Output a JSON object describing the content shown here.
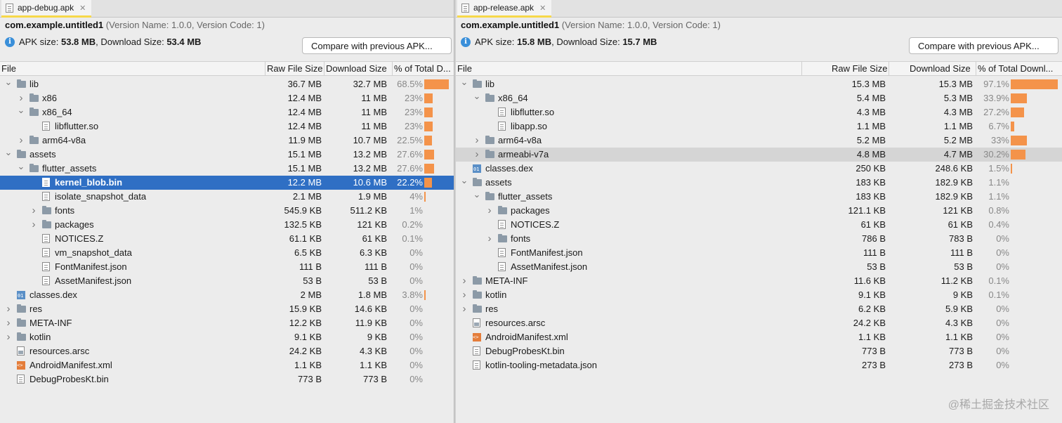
{
  "left": {
    "tab": "app-debug.apk",
    "package": "com.example.untitled1",
    "version_info": "(Version Name: 1.0.0, Version Code: 1)",
    "apk_size_label": "APK size:",
    "apk_size": "53.8 MB",
    "download_size_label": "Download Size:",
    "download_size": "53.4 MB",
    "compare_button": "Compare with previous APK...",
    "columns": [
      "File",
      "Raw File Size",
      "Download Size",
      "% of Total D..."
    ],
    "rows": [
      {
        "depth": 0,
        "arrow": "down",
        "icon": "folder",
        "name": "lib",
        "raw": "36.7 MB",
        "dl": "32.7 MB",
        "pct": "68.5%",
        "frac": 0.685
      },
      {
        "depth": 1,
        "arrow": "right",
        "icon": "folder",
        "name": "x86",
        "raw": "12.4 MB",
        "dl": "11 MB",
        "pct": "23%",
        "frac": 0.23
      },
      {
        "depth": 1,
        "arrow": "down",
        "icon": "folder",
        "name": "x86_64",
        "raw": "12.4 MB",
        "dl": "11 MB",
        "pct": "23%",
        "frac": 0.23
      },
      {
        "depth": 2,
        "arrow": "",
        "icon": "file",
        "name": "libflutter.so",
        "raw": "12.4 MB",
        "dl": "11 MB",
        "pct": "23%",
        "frac": 0.23
      },
      {
        "depth": 1,
        "arrow": "right",
        "icon": "folder",
        "name": "arm64-v8a",
        "raw": "11.9 MB",
        "dl": "10.7 MB",
        "pct": "22.5%",
        "frac": 0.225
      },
      {
        "depth": 0,
        "arrow": "down",
        "icon": "folder",
        "name": "assets",
        "raw": "15.1 MB",
        "dl": "13.2 MB",
        "pct": "27.6%",
        "frac": 0.276
      },
      {
        "depth": 1,
        "arrow": "down",
        "icon": "folder",
        "name": "flutter_assets",
        "raw": "15.1 MB",
        "dl": "13.2 MB",
        "pct": "27.6%",
        "frac": 0.276
      },
      {
        "depth": 2,
        "arrow": "",
        "icon": "file",
        "name": "kernel_blob.bin",
        "raw": "12.2 MB",
        "dl": "10.6 MB",
        "pct": "22.2%",
        "frac": 0.222,
        "selected": true
      },
      {
        "depth": 2,
        "arrow": "",
        "icon": "file",
        "name": "isolate_snapshot_data",
        "raw": "2.1 MB",
        "dl": "1.9 MB",
        "pct": "4%",
        "frac": 0.04
      },
      {
        "depth": 2,
        "arrow": "right",
        "icon": "folder",
        "name": "fonts",
        "raw": "545.9 KB",
        "dl": "511.2 KB",
        "pct": "1%",
        "frac": 0
      },
      {
        "depth": 2,
        "arrow": "right",
        "icon": "folder",
        "name": "packages",
        "raw": "132.5 KB",
        "dl": "121 KB",
        "pct": "0.2%",
        "frac": 0
      },
      {
        "depth": 2,
        "arrow": "",
        "icon": "file",
        "name": "NOTICES.Z",
        "raw": "61.1 KB",
        "dl": "61 KB",
        "pct": "0.1%",
        "frac": 0
      },
      {
        "depth": 2,
        "arrow": "",
        "icon": "file",
        "name": "vm_snapshot_data",
        "raw": "6.5 KB",
        "dl": "6.3 KB",
        "pct": "0%",
        "frac": 0
      },
      {
        "depth": 2,
        "arrow": "",
        "icon": "file",
        "name": "FontManifest.json",
        "raw": "111 B",
        "dl": "111 B",
        "pct": "0%",
        "frac": 0
      },
      {
        "depth": 2,
        "arrow": "",
        "icon": "file",
        "name": "AssetManifest.json",
        "raw": "53 B",
        "dl": "53 B",
        "pct": "0%",
        "frac": 0
      },
      {
        "depth": 0,
        "arrow": "",
        "icon": "dex",
        "name": "classes.dex",
        "raw": "2 MB",
        "dl": "1.8 MB",
        "pct": "3.8%",
        "frac": 0.038
      },
      {
        "depth": 0,
        "arrow": "right",
        "icon": "folder",
        "name": "res",
        "raw": "15.9 KB",
        "dl": "14.6 KB",
        "pct": "0%",
        "frac": 0
      },
      {
        "depth": 0,
        "arrow": "right",
        "icon": "folder",
        "name": "META-INF",
        "raw": "12.2 KB",
        "dl": "11.9 KB",
        "pct": "0%",
        "frac": 0
      },
      {
        "depth": 0,
        "arrow": "right",
        "icon": "folder",
        "name": "kotlin",
        "raw": "9.1 KB",
        "dl": "9 KB",
        "pct": "0%",
        "frac": 0
      },
      {
        "depth": 0,
        "arrow": "",
        "icon": "bin",
        "name": "resources.arsc",
        "raw": "24.2 KB",
        "dl": "4.3 KB",
        "pct": "0%",
        "frac": 0
      },
      {
        "depth": 0,
        "arrow": "",
        "icon": "xml",
        "name": "AndroidManifest.xml",
        "raw": "1.1 KB",
        "dl": "1.1 KB",
        "pct": "0%",
        "frac": 0
      },
      {
        "depth": 0,
        "arrow": "",
        "icon": "file",
        "name": "DebugProbesKt.bin",
        "raw": "773 B",
        "dl": "773 B",
        "pct": "0%",
        "frac": 0
      }
    ]
  },
  "right": {
    "tab": "app-release.apk",
    "package": "com.example.untitled1",
    "version_info": "(Version Name: 1.0.0, Version Code: 1)",
    "apk_size_label": "APK size:",
    "apk_size": "15.8 MB",
    "download_size_label": "Download Size:",
    "download_size": "15.7 MB",
    "compare_button": "Compare with previous APK...",
    "columns": [
      "File",
      "Raw File Size",
      "Download Size",
      "% of Total Downl..."
    ],
    "rows": [
      {
        "depth": 0,
        "arrow": "down",
        "icon": "folder",
        "name": "lib",
        "raw": "15.3 MB",
        "dl": "15.3 MB",
        "pct": "97.1%",
        "frac": 0.971
      },
      {
        "depth": 1,
        "arrow": "down",
        "icon": "folder",
        "name": "x86_64",
        "raw": "5.4 MB",
        "dl": "5.3 MB",
        "pct": "33.9%",
        "frac": 0.339
      },
      {
        "depth": 2,
        "arrow": "",
        "icon": "file",
        "name": "libflutter.so",
        "raw": "4.3 MB",
        "dl": "4.3 MB",
        "pct": "27.2%",
        "frac": 0.272
      },
      {
        "depth": 2,
        "arrow": "",
        "icon": "file",
        "name": "libapp.so",
        "raw": "1.1 MB",
        "dl": "1.1 MB",
        "pct": "6.7%",
        "frac": 0.067
      },
      {
        "depth": 1,
        "arrow": "right",
        "icon": "folder",
        "name": "arm64-v8a",
        "raw": "5.2 MB",
        "dl": "5.2 MB",
        "pct": "33%",
        "frac": 0.33
      },
      {
        "depth": 1,
        "arrow": "right",
        "icon": "folder",
        "name": "armeabi-v7a",
        "raw": "4.8 MB",
        "dl": "4.7 MB",
        "pct": "30.2%",
        "frac": 0.302,
        "hover": true
      },
      {
        "depth": 0,
        "arrow": "",
        "icon": "dex",
        "name": "classes.dex",
        "raw": "250 KB",
        "dl": "248.6 KB",
        "pct": "1.5%",
        "frac": 0.015
      },
      {
        "depth": 0,
        "arrow": "down",
        "icon": "folder",
        "name": "assets",
        "raw": "183 KB",
        "dl": "182.9 KB",
        "pct": "1.1%",
        "frac": 0
      },
      {
        "depth": 1,
        "arrow": "down",
        "icon": "folder",
        "name": "flutter_assets",
        "raw": "183 KB",
        "dl": "182.9 KB",
        "pct": "1.1%",
        "frac": 0
      },
      {
        "depth": 2,
        "arrow": "right",
        "icon": "folder",
        "name": "packages",
        "raw": "121.1 KB",
        "dl": "121 KB",
        "pct": "0.8%",
        "frac": 0
      },
      {
        "depth": 2,
        "arrow": "",
        "icon": "file",
        "name": "NOTICES.Z",
        "raw": "61 KB",
        "dl": "61 KB",
        "pct": "0.4%",
        "frac": 0
      },
      {
        "depth": 2,
        "arrow": "right",
        "icon": "folder",
        "name": "fonts",
        "raw": "786 B",
        "dl": "783 B",
        "pct": "0%",
        "frac": 0
      },
      {
        "depth": 2,
        "arrow": "",
        "icon": "file",
        "name": "FontManifest.json",
        "raw": "111 B",
        "dl": "111 B",
        "pct": "0%",
        "frac": 0
      },
      {
        "depth": 2,
        "arrow": "",
        "icon": "file",
        "name": "AssetManifest.json",
        "raw": "53 B",
        "dl": "53 B",
        "pct": "0%",
        "frac": 0
      },
      {
        "depth": 0,
        "arrow": "right",
        "icon": "folder",
        "name": "META-INF",
        "raw": "11.6 KB",
        "dl": "11.2 KB",
        "pct": "0.1%",
        "frac": 0
      },
      {
        "depth": 0,
        "arrow": "right",
        "icon": "folder",
        "name": "kotlin",
        "raw": "9.1 KB",
        "dl": "9 KB",
        "pct": "0.1%",
        "frac": 0
      },
      {
        "depth": 0,
        "arrow": "right",
        "icon": "folder",
        "name": "res",
        "raw": "6.2 KB",
        "dl": "5.9 KB",
        "pct": "0%",
        "frac": 0
      },
      {
        "depth": 0,
        "arrow": "",
        "icon": "bin",
        "name": "resources.arsc",
        "raw": "24.2 KB",
        "dl": "4.3 KB",
        "pct": "0%",
        "frac": 0
      },
      {
        "depth": 0,
        "arrow": "",
        "icon": "xml",
        "name": "AndroidManifest.xml",
        "raw": "1.1 KB",
        "dl": "1.1 KB",
        "pct": "0%",
        "frac": 0
      },
      {
        "depth": 0,
        "arrow": "",
        "icon": "file",
        "name": "DebugProbesKt.bin",
        "raw": "773 B",
        "dl": "773 B",
        "pct": "0%",
        "frac": 0
      },
      {
        "depth": 0,
        "arrow": "",
        "icon": "file",
        "name": "kotlin-tooling-metadata.json",
        "raw": "273 B",
        "dl": "273 B",
        "pct": "0%",
        "frac": 0
      }
    ]
  },
  "watermark": "@稀土掘金技术社区",
  "colors": {
    "selection": "#2f6fc4",
    "bar": "#f4934a",
    "tab_underline": "#f6d84a",
    "info_icon": "#3a8fd9"
  }
}
